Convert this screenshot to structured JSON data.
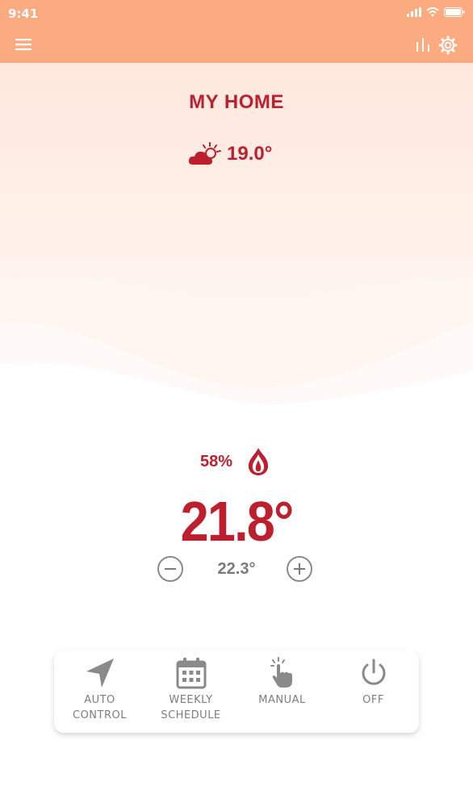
{
  "status_bar": {
    "time": "9:41"
  },
  "home": {
    "title": "MY HOME"
  },
  "weather": {
    "outdoor_temp": "19.0°"
  },
  "heating": {
    "level": "58%"
  },
  "thermostat": {
    "current_temp": "21.8°",
    "set_temp": "22.3°"
  },
  "modes": [
    {
      "label": "AUTO\nCONTROL",
      "icon": "navigation-arrow-icon"
    },
    {
      "label": "WEEKLY\nSCHEDULE",
      "icon": "calendar-icon"
    },
    {
      "label": "MANUAL",
      "icon": "hand-tap-icon"
    },
    {
      "label": "OFF",
      "icon": "power-icon"
    }
  ],
  "colors": {
    "header": "#fcaa80",
    "accent": "#bd1f2e",
    "muted": "#7d7d7d"
  }
}
